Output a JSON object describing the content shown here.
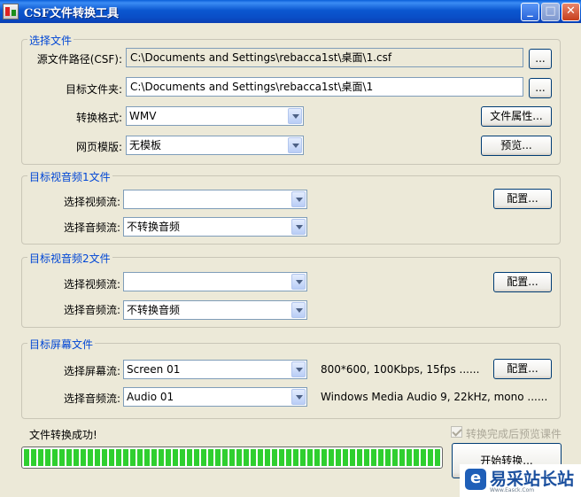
{
  "window": {
    "title": "CSF文件转换工具"
  },
  "titlebar": {
    "minimize": "_",
    "maximize": "□",
    "close": "✕"
  },
  "source_group": {
    "legend": "选择文件",
    "source_label": "源文件路径(CSF):",
    "source_value": "C:\\Documents and Settings\\rebacca1st\\桌面\\1.csf",
    "target_label": "目标文件夹:",
    "target_value": "C:\\Documents and Settings\\rebacca1st\\桌面\\1",
    "browse_label": "...",
    "format_label": "转换格式:",
    "format_value": "WMV",
    "file_props_button": "文件属性...",
    "template_label": "网页模版:",
    "template_value": "无模板",
    "preview_button": "预览..."
  },
  "av1_group": {
    "legend": "目标视音频1文件",
    "video_label": "选择视频流:",
    "video_value": "",
    "audio_label": "选择音频流:",
    "audio_value": "不转换音频",
    "config_button": "配置..."
  },
  "av2_group": {
    "legend": "目标视音频2文件",
    "video_label": "选择视频流:",
    "video_value": "",
    "audio_label": "选择音频流:",
    "audio_value": "不转换音频",
    "config_button": "配置..."
  },
  "screen_group": {
    "legend": "目标屏幕文件",
    "screen_label": "选择屏幕流:",
    "screen_value": "Screen 01",
    "screen_info": "800*600, 100Kbps, 15fps ......",
    "config_button": "配置...",
    "audio_label": "选择音频流:",
    "audio_value": "Audio 01",
    "audio_info": "Windows Media Audio 9, 22kHz, mono ......"
  },
  "footer": {
    "status": "文件转换成功!",
    "preview_checkbox_label": "转换完成后预览课件",
    "preview_checked": true,
    "progress_percent": 100,
    "start_button": "开始转换..."
  },
  "watermark": {
    "text": "易采站长站",
    "sub": "Www.Easck.Com"
  },
  "colors": {
    "titlebar": "#0a4ec7",
    "legend": "#0046d5",
    "progress": "#2fcf2f",
    "face": "#ece9d8"
  }
}
